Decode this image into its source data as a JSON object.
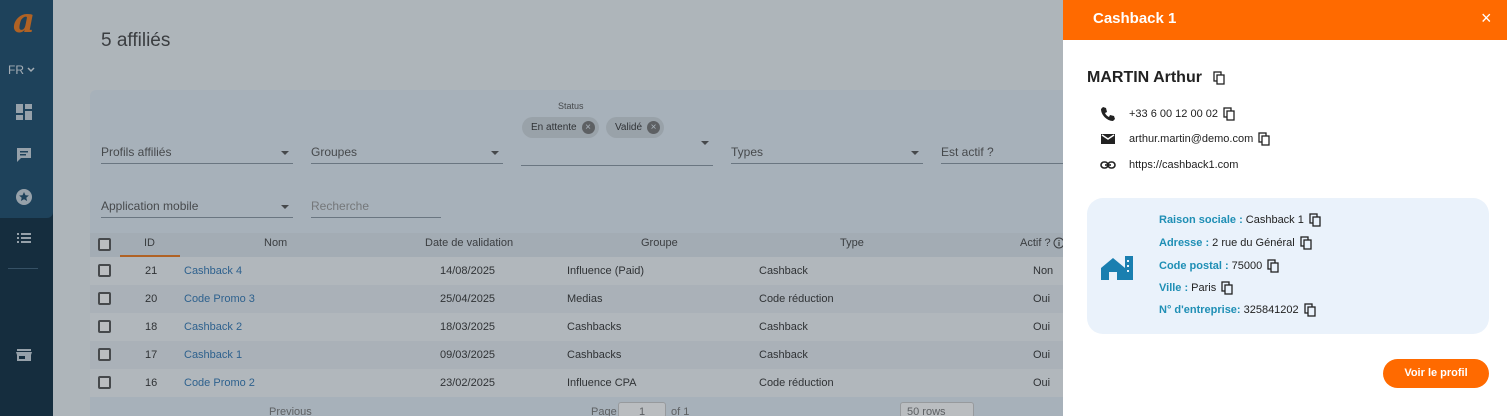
{
  "sidebar": {
    "logo": "a",
    "lang": "FR",
    "icons": [
      "dashboard-icon",
      "chat-icon",
      "star-icon",
      "list-icon",
      "store-icon"
    ]
  },
  "main": {
    "title": "5 affiliés",
    "filters": {
      "profils": "Profils affiliés",
      "groupes": "Groupes",
      "status_label": "Status",
      "status_chips": [
        "En attente",
        "Validé"
      ],
      "types": "Types",
      "est_actif": "Est actif ?",
      "application": "Application mobile",
      "recherche_placeholder": "Recherche"
    },
    "table": {
      "headers": [
        "ID",
        "Nom",
        "Date de validation",
        "Groupe",
        "Type",
        "Actif ?"
      ],
      "rows": [
        {
          "id": "21",
          "nom": "Cashback 4",
          "date": "14/08/2025",
          "groupe": "Influence (Paid)",
          "type": "Cashback",
          "actif": "Non"
        },
        {
          "id": "20",
          "nom": "Code Promo 3",
          "date": "25/04/2025",
          "groupe": "Medias",
          "type": "Code réduction",
          "actif": "Oui"
        },
        {
          "id": "18",
          "nom": "Cashback 2",
          "date": "18/03/2025",
          "groupe": "Cashbacks",
          "type": "Cashback",
          "actif": "Oui"
        },
        {
          "id": "17",
          "nom": "Cashback 1",
          "date": "09/03/2025",
          "groupe": "Cashbacks",
          "type": "Cashback",
          "actif": "Oui"
        },
        {
          "id": "16",
          "nom": "Code Promo 2",
          "date": "23/02/2025",
          "groupe": "Influence CPA",
          "type": "Code réduction",
          "actif": "Oui"
        }
      ]
    },
    "pager": {
      "previous": "Previous",
      "page_label": "Page",
      "page_value": "1",
      "of": "of 1",
      "rows": "50 rows"
    }
  },
  "drawer": {
    "title": "Cashback 1",
    "close": "×",
    "name": "MARTIN Arthur",
    "phone": "+33 6 00 12 00 02",
    "email": "arthur.martin@demo.com",
    "website": "https://cashback1.com",
    "company": {
      "raison_label": "Raison sociale :",
      "raison_value": "Cashback 1",
      "adresse_label": "Adresse :",
      "adresse_value": "2 rue du Général",
      "cp_label": "Code postal :",
      "cp_value": "75000",
      "ville_label": "Ville :",
      "ville_value": "Paris",
      "entreprise_label": "N° d'entreprise:",
      "entreprise_value": "325841202"
    },
    "profile_button": "Voir le profil"
  },
  "colors": {
    "accent": "#ff6a00",
    "link": "#3178b5",
    "label": "#1f8fb5",
    "sidebar": "#0d2b40"
  }
}
